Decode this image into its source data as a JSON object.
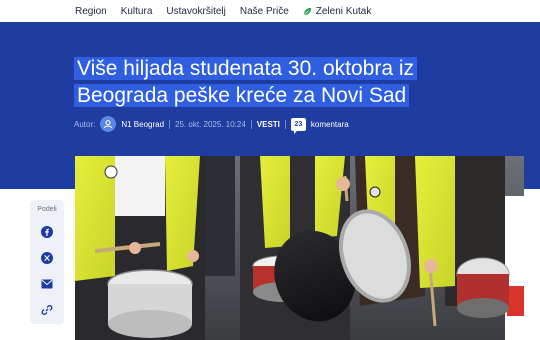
{
  "nav": {
    "items": [
      "Region",
      "Kultura",
      "Ustavokršitelj",
      "Naše Priče",
      "Zeleni Kutak"
    ]
  },
  "article": {
    "headline_line1": "Više hiljada studenata 30. oktobra iz",
    "headline_line2": "Beograda peške kreće za Novi Sad",
    "author_label": "Autor:",
    "author_name": "N1 Beograd",
    "date": "25. okt. 2025. 10:24",
    "category": "VESTI",
    "comment_count": "23",
    "comments_label": "komentara"
  },
  "share": {
    "label": "Podeli"
  },
  "colors": {
    "hero_bg": "#1f3ca0",
    "headline_highlight": "#2f5fe0",
    "accent_green": "#1fa84a"
  },
  "icons": [
    "leaf-icon",
    "user-icon",
    "comment-icon",
    "facebook-icon",
    "x-icon",
    "mail-icon",
    "link-icon"
  ]
}
